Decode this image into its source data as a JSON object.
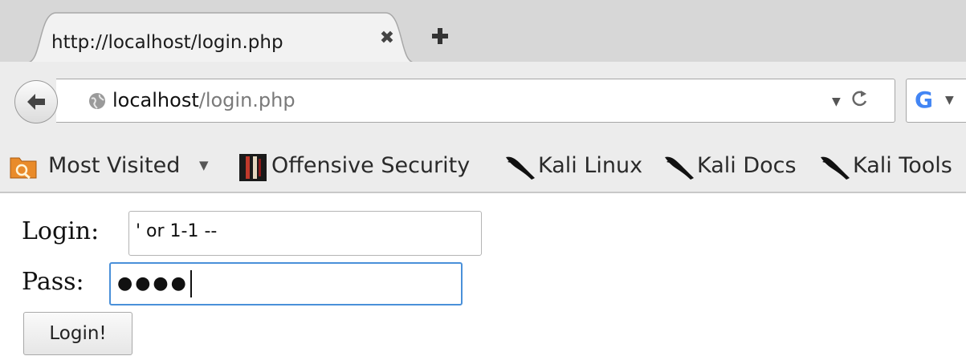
{
  "tab": {
    "title": "http://localhost/login.php",
    "close_glyph": "✖"
  },
  "navbar": {
    "url_host": "localhost",
    "url_path": "/login.php",
    "dropdown_glyph": "▼",
    "reload_glyph": "C",
    "search_engine_letter": "G",
    "search_dropdown_glyph": "▼"
  },
  "bookmarks": [
    {
      "label": "Most Visited",
      "icon": "most-visited-folder-icon",
      "suffix": "▼"
    },
    {
      "label": "Offensive Security",
      "icon": "offensive-security-icon"
    },
    {
      "label": "Kali Linux",
      "icon": "kali-dragon-icon"
    },
    {
      "label": "Kali Docs",
      "icon": "kali-dragon-icon"
    },
    {
      "label": "Kali Tools",
      "icon": "kali-dragon-icon"
    }
  ],
  "form": {
    "login_label": "Login:",
    "login_value": "' or 1-1 --",
    "pass_label": "Pass:",
    "pass_value": "●●●●",
    "submit_label": "Login!"
  },
  "colors": {
    "chrome_bg": "#ececec",
    "tab_strip_bg": "#d7d7d7",
    "focus_border": "#4a90d9",
    "google_blue": "#4285f4"
  }
}
